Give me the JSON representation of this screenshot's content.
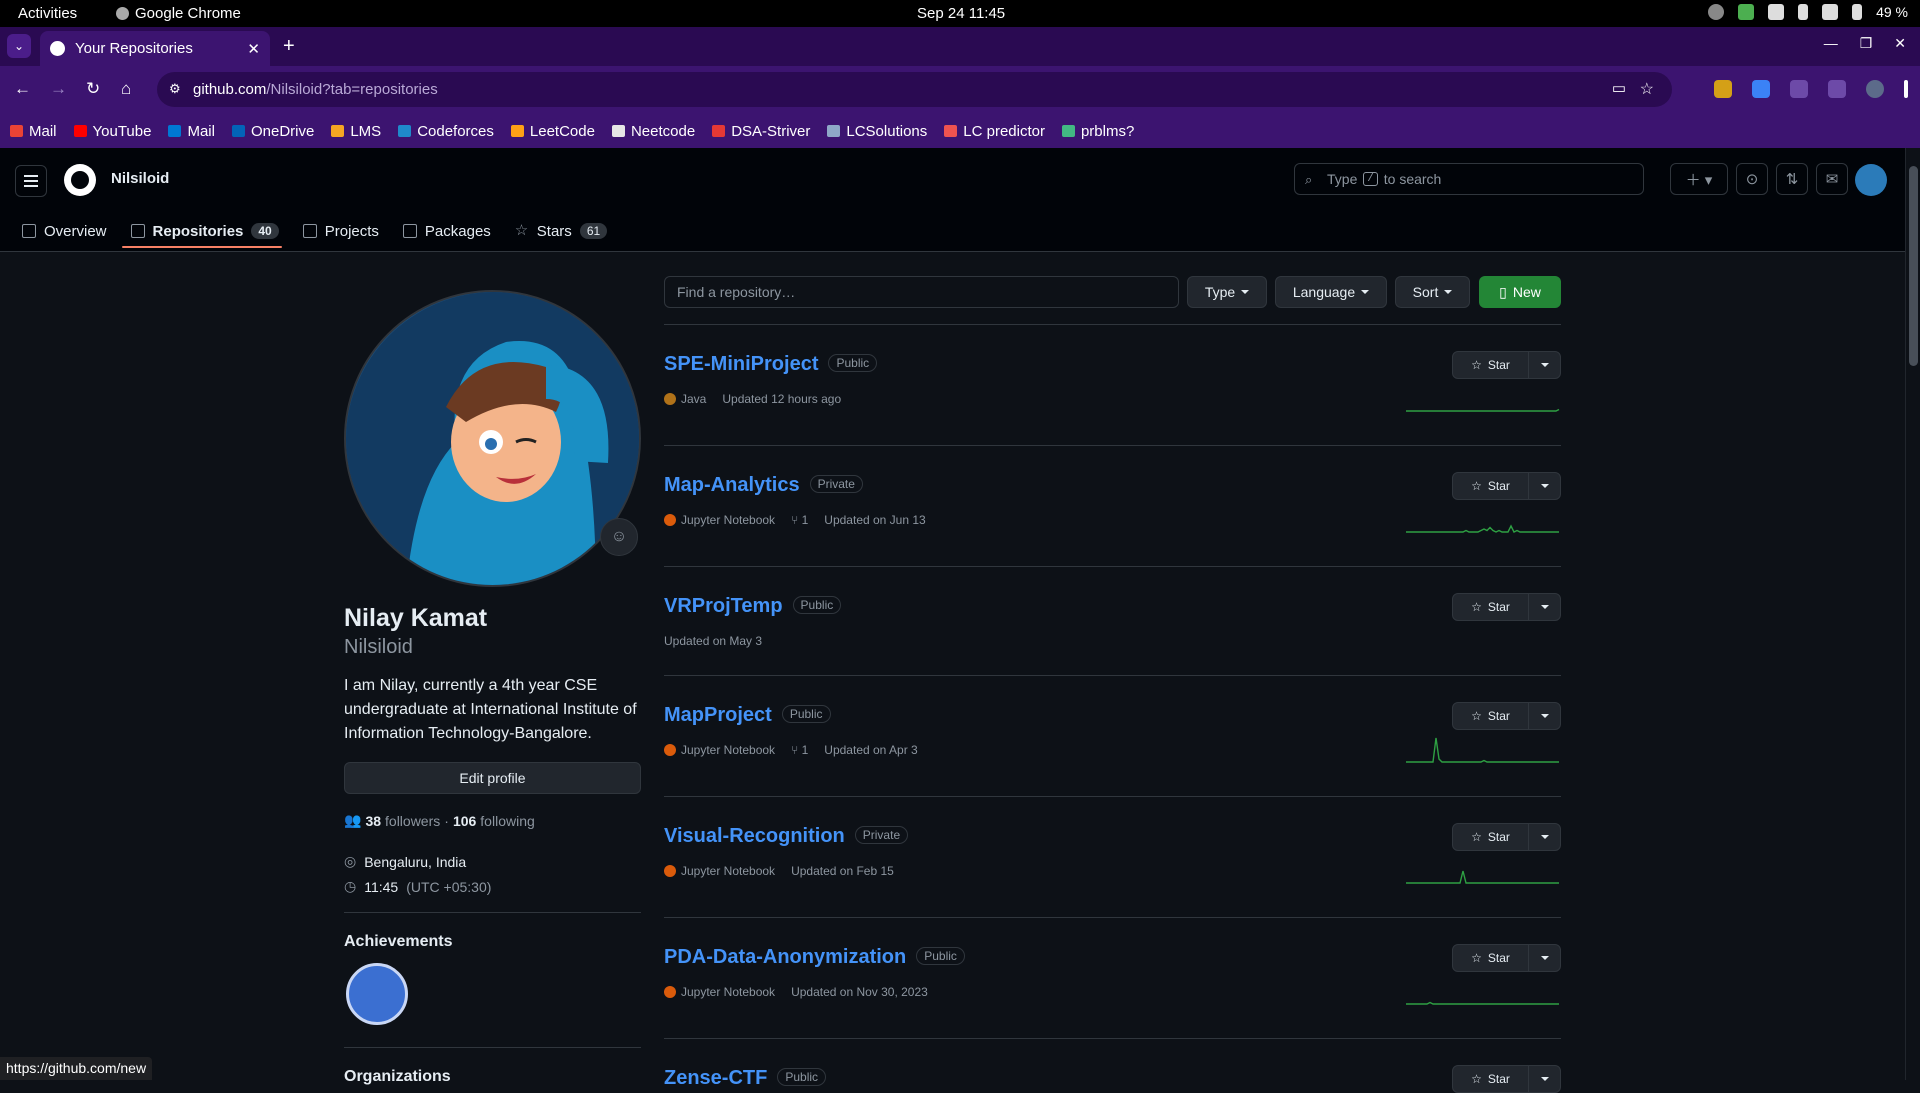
{
  "os": {
    "activities": "Activities",
    "app": "Google Chrome",
    "clock": "Sep 24  11:45",
    "battery": "49 %"
  },
  "browser": {
    "tab_title": "Your Repositories",
    "url_host": "github.com",
    "url_path": "/Nilsiloid?tab=repositories",
    "bookmarks": [
      "Mail",
      "YouTube",
      "Mail",
      "OneDrive",
      "LMS",
      "Codeforces",
      "LeetCode",
      "Neetcode",
      "DSA-Striver",
      "LCSolutions",
      "LC predictor",
      "prblms?"
    ],
    "bookmark_colors": [
      "#ea4335",
      "#ff0000",
      "#0078d4",
      "#0364b8",
      "#f5a623",
      "#1f8acb",
      "#ffa116",
      "#e6e6e6",
      "#e53935",
      "#8fa8c8",
      "#ef5350",
      "#42b883"
    ],
    "status_url": "https://github.com/new"
  },
  "github": {
    "username": "Nilsiloid",
    "search_pre": "Type",
    "search_key": "/",
    "search_post": "to search",
    "nav": [
      {
        "label": "Overview"
      },
      {
        "label": "Repositories",
        "count": "40"
      },
      {
        "label": "Projects"
      },
      {
        "label": "Packages"
      },
      {
        "label": "Stars",
        "count": "61"
      }
    ]
  },
  "profile": {
    "name": "Nilay Kamat",
    "login": "Nilsiloid",
    "bio": "I am Nilay, currently a 4th year CSE undergraduate at International Institute of Information Technology-Bangalore.",
    "edit_label": "Edit profile",
    "followers": "38",
    "followers_label": "followers",
    "following": "106",
    "following_label": "following",
    "location": "Bengaluru, India",
    "local_time": "11:45",
    "utc_offset": "(UTC +05:30)",
    "achievements_title": "Achievements",
    "organizations_title": "Organizations"
  },
  "repos_toolbar": {
    "find_placeholder": "Find a repository…",
    "type_label": "Type",
    "language_label": "Language",
    "sort_label": "Sort",
    "new_label": "New"
  },
  "repos": [
    {
      "name": "SPE-MiniProject",
      "visibility": "Public",
      "language": "Java",
      "lang_color": "#b07219",
      "forks": "",
      "updated": "Updated 12 hours ago",
      "star_label": "Star",
      "activity": [
        0,
        0,
        0,
        0,
        0,
        0,
        0,
        0,
        0,
        0,
        0,
        0,
        0,
        0,
        0,
        0,
        0,
        0,
        0,
        0,
        0,
        0,
        0,
        0,
        0,
        0,
        0,
        0,
        0,
        0,
        0,
        0,
        0,
        0,
        0,
        0,
        0,
        0,
        0,
        0,
        0,
        0,
        0,
        0,
        0,
        0,
        0,
        0,
        0,
        0,
        0,
        1
      ]
    },
    {
      "name": "Map-Analytics",
      "visibility": "Private",
      "language": "Jupyter Notebook",
      "lang_color": "#da5b0b",
      "forks": "1",
      "updated": "Updated on Jun 13",
      "star_label": "Star",
      "activity": [
        0,
        0,
        0,
        0,
        0,
        0,
        0,
        0,
        0,
        0,
        0,
        0,
        0,
        0,
        0,
        0,
        0,
        0,
        0,
        0,
        1,
        0,
        0,
        0,
        0,
        1,
        2,
        1,
        3,
        1,
        0,
        1,
        0,
        0,
        0,
        4,
        0,
        1,
        0,
        0,
        0,
        0,
        0,
        0,
        0,
        0,
        0,
        0,
        0,
        0,
        0,
        0
      ]
    },
    {
      "name": "VRProjTemp",
      "visibility": "Public",
      "language": "",
      "lang_color": "",
      "forks": "",
      "updated": "Updated on May 3",
      "star_label": "Star",
      "activity": []
    },
    {
      "name": "MapProject",
      "visibility": "Public",
      "language": "Jupyter Notebook",
      "lang_color": "#da5b0b",
      "forks": "1",
      "updated": "Updated on Apr 3",
      "star_label": "Star",
      "activity": [
        0,
        0,
        0,
        0,
        0,
        0,
        0,
        0,
        0,
        0,
        16,
        2,
        0,
        0,
        0,
        0,
        0,
        0,
        0,
        0,
        0,
        0,
        0,
        0,
        0,
        0,
        1,
        0,
        0,
        0,
        0,
        0,
        0,
        0,
        0,
        0,
        0,
        0,
        0,
        0,
        0,
        0,
        0,
        0,
        0,
        0,
        0,
        0,
        0,
        0,
        0,
        0
      ]
    },
    {
      "name": "Visual-Recognition",
      "visibility": "Private",
      "language": "Jupyter Notebook",
      "lang_color": "#da5b0b",
      "forks": "",
      "updated": "Updated on Feb 15",
      "star_label": "Star",
      "activity": [
        0,
        0,
        0,
        0,
        0,
        0,
        0,
        0,
        0,
        0,
        0,
        0,
        0,
        0,
        0,
        0,
        0,
        0,
        0,
        8,
        0,
        0,
        0,
        0,
        0,
        0,
        0,
        0,
        0,
        0,
        0,
        0,
        0,
        0,
        0,
        0,
        0,
        0,
        0,
        0,
        0,
        0,
        0,
        0,
        0,
        0,
        0,
        0,
        0,
        0,
        0,
        0
      ]
    },
    {
      "name": "PDA-Data-Anonymization",
      "visibility": "Public",
      "language": "Jupyter Notebook",
      "lang_color": "#da5b0b",
      "forks": "",
      "updated": "Updated on Nov 30, 2023",
      "star_label": "Star",
      "activity": [
        0,
        0,
        0,
        0,
        0,
        0,
        0,
        0,
        1,
        0,
        0,
        0,
        0,
        0,
        0,
        0,
        0,
        0,
        0,
        0,
        0,
        0,
        0,
        0,
        0,
        0,
        0,
        0,
        0,
        0,
        0,
        0,
        0,
        0,
        0,
        0,
        0,
        0,
        0,
        0,
        0,
        0,
        0,
        0,
        0,
        0,
        0,
        0,
        0,
        0,
        0,
        0
      ]
    },
    {
      "name": "Zense-CTF",
      "visibility": "Public",
      "language": "",
      "lang_color": "",
      "forks": "",
      "updated": "",
      "star_label": "Star",
      "activity": []
    }
  ]
}
